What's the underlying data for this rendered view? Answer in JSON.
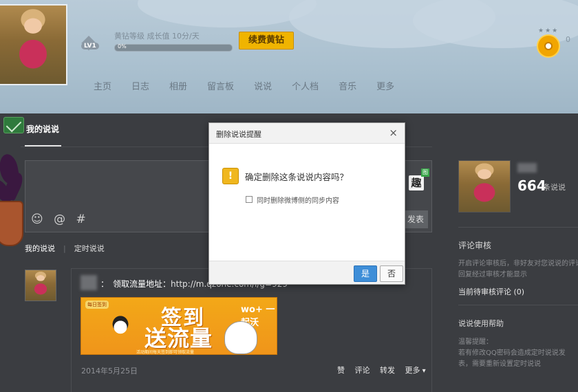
{
  "header": {
    "vip_info": "黄钻等级  成长值 10分/天",
    "progress_text": "0%",
    "progress_value": 0,
    "level_badge": "LV1",
    "renew_button": "续费黄钻",
    "side_text": "0",
    "nav": [
      "主页",
      "日志",
      "相册",
      "留言板",
      "说说",
      "个人档",
      "音乐",
      "更多"
    ]
  },
  "tabs": {
    "active": "我的说说"
  },
  "composer": {
    "tools": [
      "☺",
      "@",
      "#"
    ],
    "qu_icon": "趣",
    "qu_badge": "图",
    "publish": "发表"
  },
  "subtabs": {
    "mine": "我的说说",
    "scheduled": "定时说说"
  },
  "post": {
    "text": "领取流量地址：",
    "url": "http://m.qzone.com/l/g=929",
    "promo": {
      "tag": "每日签到",
      "line1": "签到",
      "line2": "送流量",
      "brand": "wo+ 一起沃",
      "footer": "活动期间每天签到即可领取流量"
    },
    "date": "2014年5月25日",
    "actions": [
      "赞",
      "评论",
      "转发",
      "更多"
    ]
  },
  "right": {
    "count": "664",
    "count_label": "条说说",
    "review_title": "评论审核",
    "review_desc": [
      "开启评论审核后，非好友对您说说的评论",
      "回复经过审核才能显示"
    ],
    "pending": "当前待审核评论 (0)",
    "help_title": "说说使用帮助",
    "help_desc": [
      "温馨提醒：",
      "若有修改QQ密码会造成定时说说发",
      "表，需要重新设置定时说说"
    ]
  },
  "modal": {
    "title": "删除说说提醒",
    "close": "×",
    "warn_glyph": "!",
    "message": "确定删除这条说说内容吗？",
    "checkbox_label": "同时删除微博侧的同步内容",
    "yes": "是",
    "no": "否"
  }
}
